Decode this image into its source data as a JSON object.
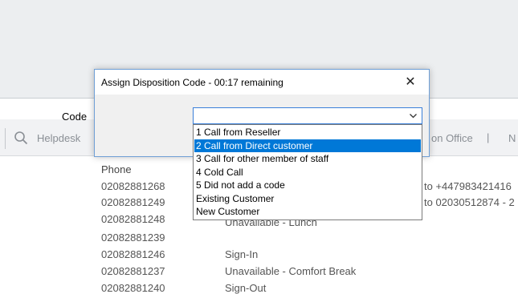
{
  "toolbar": {
    "search_label": "Helpdesk",
    "office_label": "on Office",
    "separator": "|",
    "truncated_label": "N"
  },
  "table": {
    "phone_header": "Phone",
    "rows": [
      {
        "phone": "02082881268",
        "status": "",
        "note": "to +447983421416"
      },
      {
        "phone": "02082881249",
        "status": "",
        "note": "to 02030512874 - 2"
      },
      {
        "phone": "02082881248",
        "status": "Unavailable - Lunch",
        "note": ""
      },
      {
        "phone": "02082881239",
        "status": "",
        "note": ""
      },
      {
        "phone": "02082881246",
        "status": "Sign-In",
        "note": ""
      },
      {
        "phone": "02082881237",
        "status": "Unavailable - Comfort Break",
        "note": ""
      },
      {
        "phone": "02082881240",
        "status": "Sign-Out",
        "note": ""
      }
    ]
  },
  "dialog": {
    "title": "Assign Disposition Code - 00:17 remaining",
    "close_glyph": "✕",
    "code_label": "Code",
    "selected_value": "",
    "options": [
      "1 Call from Reseller",
      "2 Call from Direct customer",
      "3 Call for other member of staff",
      "4 Cold Call",
      "5 Did not add a code",
      "Existing Customer",
      "New Customer"
    ],
    "highlighted_index": 1
  },
  "colors": {
    "accent": "#0078d7",
    "dialog_border": "#6f9fd6",
    "muted_text": "#8a8f95"
  }
}
